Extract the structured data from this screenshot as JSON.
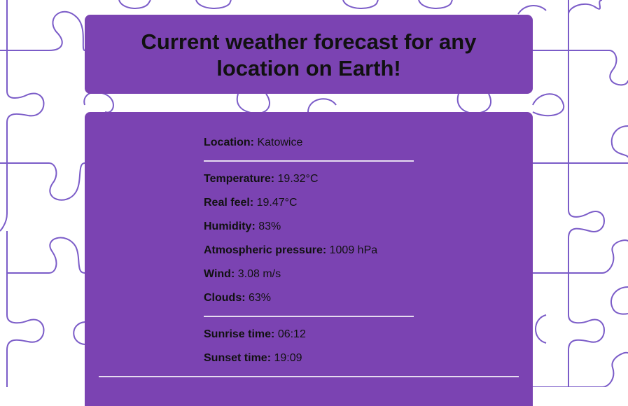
{
  "header": {
    "title": "Current weather forecast for any location on Earth!"
  },
  "weather": {
    "location": {
      "label": "Location:",
      "value": "Katowice"
    },
    "temperature": {
      "label": "Temperature:",
      "value": "19.32°C"
    },
    "real_feel": {
      "label": "Real feel:",
      "value": "19.47°C"
    },
    "humidity": {
      "label": "Humidity:",
      "value": "83%"
    },
    "pressure": {
      "label": "Atmospheric pressure:",
      "value": "1009 hPa"
    },
    "wind": {
      "label": "Wind:",
      "value": "3.08 m/s"
    },
    "clouds": {
      "label": "Clouds:",
      "value": "63%"
    },
    "sunrise": {
      "label": "Sunrise time:",
      "value": "06:12"
    },
    "sunset": {
      "label": "Sunset time:",
      "value": "19:09"
    }
  },
  "colors": {
    "card": "#7b43b2",
    "pattern_stroke": "#7b5cc8",
    "text": "#111111",
    "divider": "#e6dcf0"
  }
}
